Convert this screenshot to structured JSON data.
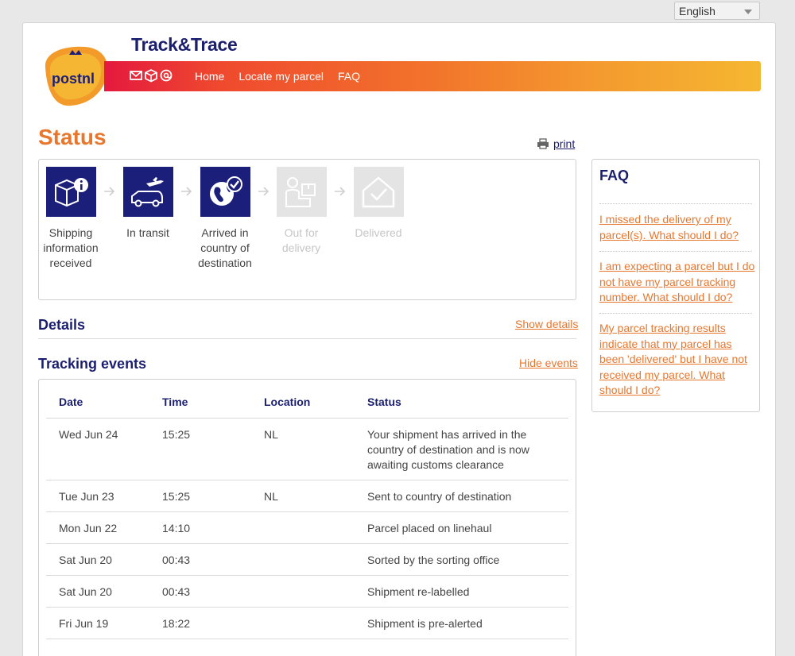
{
  "language": {
    "selected": "English"
  },
  "header": {
    "brand_title": "Track&Trace",
    "logo_text": "postnl",
    "nav": {
      "home": "Home",
      "locate": "Locate my parcel",
      "faq": "FAQ"
    }
  },
  "status": {
    "title": "Status",
    "print_label": "print",
    "steps": [
      {
        "label": "Shipping information received",
        "done": true,
        "icon": "parcel-info-icon"
      },
      {
        "label": "In transit",
        "done": true,
        "icon": "plane-van-icon"
      },
      {
        "label": "Arrived in country of destination",
        "done": true,
        "icon": "globe-check-icon"
      },
      {
        "label": "Out for delivery",
        "done": false,
        "icon": "courier-icon"
      },
      {
        "label": "Delivered",
        "done": false,
        "icon": "house-check-icon"
      }
    ]
  },
  "details": {
    "title": "Details",
    "toggle": "Show details"
  },
  "events": {
    "title": "Tracking events",
    "toggle": "Hide events",
    "columns": {
      "date": "Date",
      "time": "Time",
      "location": "Location",
      "status": "Status"
    },
    "rows": [
      {
        "date": "Wed Jun 24",
        "time": "15:25",
        "location": "NL",
        "status": "Your shipment has arrived in the country of destination and is now awaiting customs clearance"
      },
      {
        "date": "Tue Jun 23",
        "time": "15:25",
        "location": "NL",
        "status": "Sent to country of destination"
      },
      {
        "date": "Mon Jun 22",
        "time": "14:10",
        "location": "",
        "status": "Parcel placed on linehaul"
      },
      {
        "date": "Sat Jun 20",
        "time": "00:43",
        "location": "",
        "status": "Sorted by the sorting office"
      },
      {
        "date": "Sat Jun 20",
        "time": "00:43",
        "location": "",
        "status": "Shipment re-labelled"
      },
      {
        "date": "Fri Jun 19",
        "time": "18:22",
        "location": "",
        "status": "Shipment is pre-alerted"
      }
    ]
  },
  "faq": {
    "title": "FAQ",
    "items": [
      "I missed the delivery of my parcel(s). What should I do?",
      "I am expecting a parcel but I do not have my parcel tracking number. What should I do?",
      "My parcel tracking results indicate that my parcel has been 'delivered' but I have not received my parcel. What should I do?"
    ]
  },
  "colors": {
    "navy": "#1b1f6e",
    "orange": "#e8772e",
    "gradient_start": "#e4193e",
    "gradient_end": "#f5b731"
  }
}
